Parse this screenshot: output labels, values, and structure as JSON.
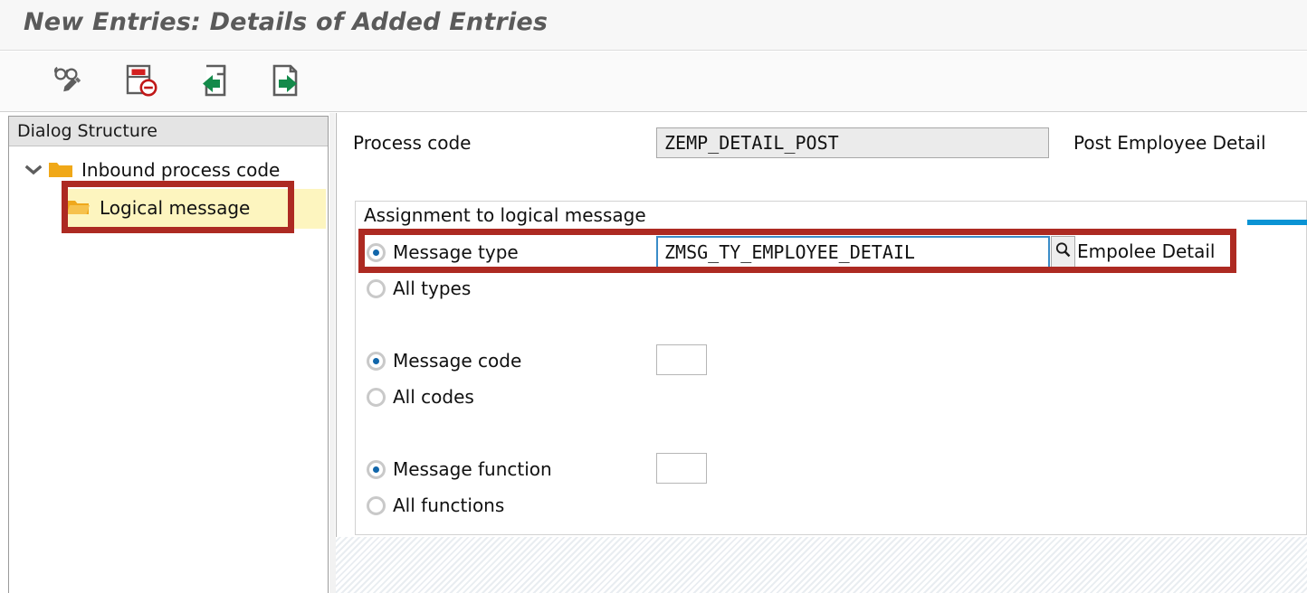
{
  "window": {
    "title": "New Entries: Details of Added Entries"
  },
  "toolbar": {
    "buttons": [
      {
        "name": "display-change-icon",
        "label": "Display/Change"
      },
      {
        "name": "delete-entry-icon",
        "label": "Delete"
      },
      {
        "name": "previous-entry-icon",
        "label": "Previous Entry"
      },
      {
        "name": "next-entry-icon",
        "label": "Next Entry"
      }
    ]
  },
  "tree": {
    "header": "Dialog Structure",
    "items": [
      {
        "label": "Inbound process code",
        "expanded": true,
        "selected": false
      },
      {
        "label": "Logical message",
        "expanded": false,
        "selected": true
      }
    ]
  },
  "main": {
    "process_code_label": "Process code",
    "process_code_value": "ZEMP_DETAIL_POST",
    "process_code_description": "Post Employee Detail",
    "group": {
      "title": "Assignment to logical message",
      "message_type": {
        "radio_label": "Message type",
        "radio_selected": true,
        "value": "ZMSG_TY_EMPLOYEE_DETAIL",
        "description": "Empolee Detail",
        "f4_icon": "search-icon"
      },
      "all_types": {
        "radio_label": "All types",
        "radio_selected": false
      },
      "message_code": {
        "radio_label": "Message code",
        "radio_selected": true,
        "value": ""
      },
      "all_codes": {
        "radio_label": "All codes",
        "radio_selected": false
      },
      "message_function": {
        "radio_label": "Message function",
        "radio_selected": true,
        "value": ""
      },
      "all_functions": {
        "radio_label": "All functions",
        "radio_selected": false
      }
    }
  },
  "colors": {
    "annotation_red": "#ad2a22",
    "highlight_yellow": "#fdf5bf",
    "focus_blue": "#3a8cc8",
    "radio_blue": "#1166aa",
    "accent_blue": "#0a93d4",
    "folder_orange": "#f0a818"
  }
}
